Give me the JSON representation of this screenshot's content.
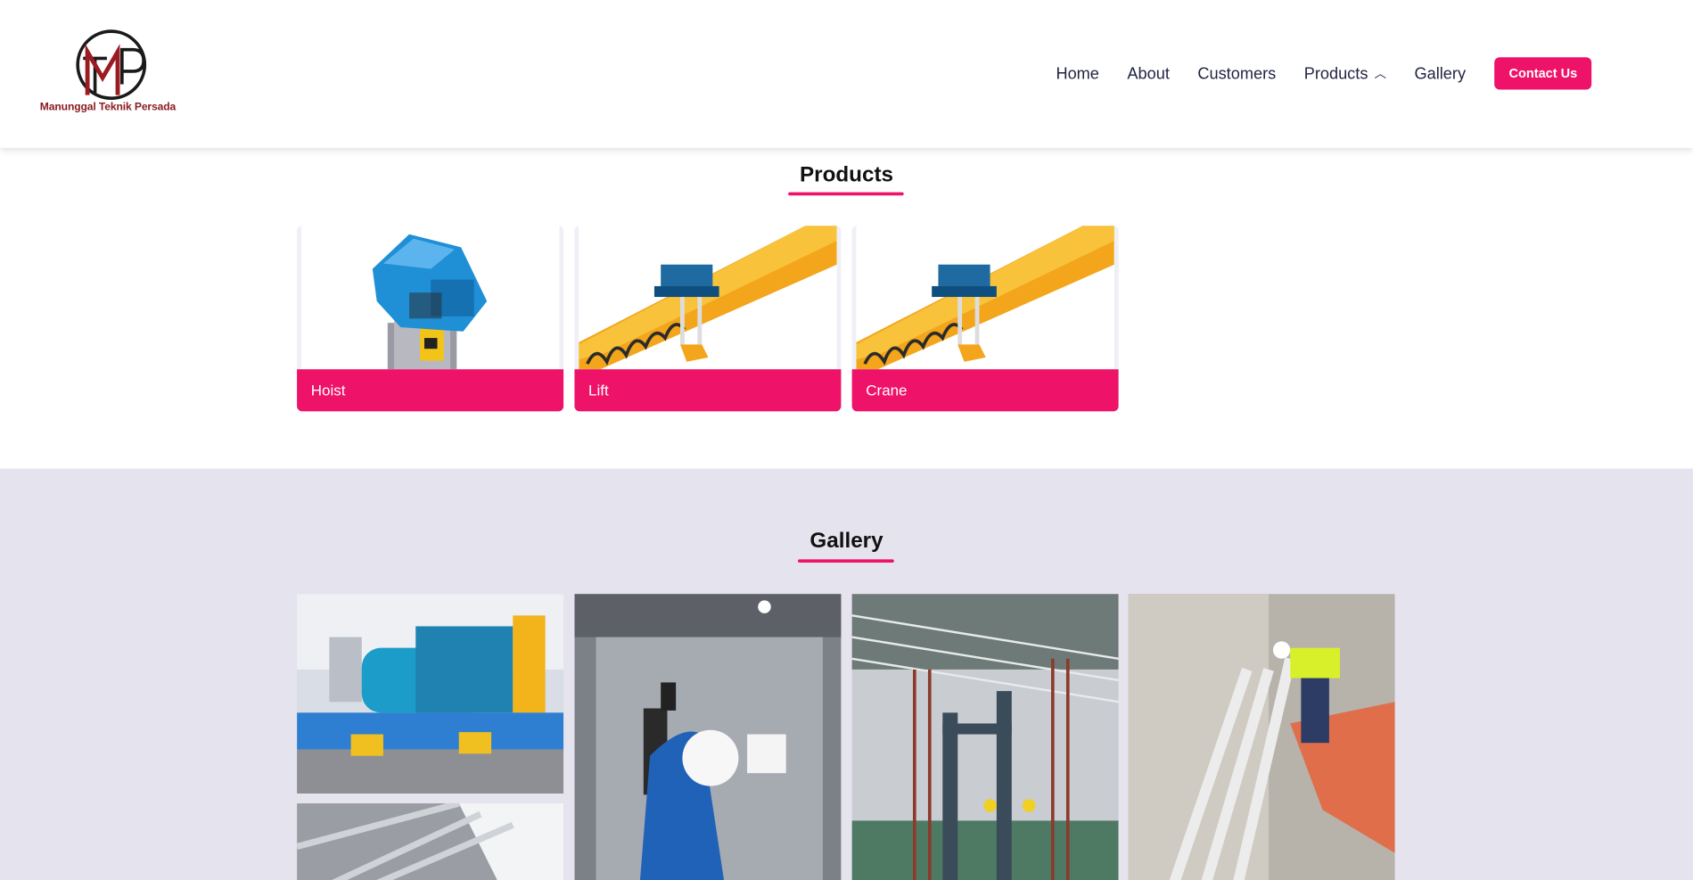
{
  "brand": {
    "name": "Manunggal Teknik Persada",
    "logo_letters": "TMP",
    "colors": {
      "dark_red": "#8a1c22",
      "accent": "#ee1268"
    }
  },
  "nav": {
    "items": [
      {
        "label": "Home"
      },
      {
        "label": "About"
      },
      {
        "label": "Customers"
      },
      {
        "label": "Products",
        "icon": "chevron-up-icon"
      },
      {
        "label": "Gallery"
      }
    ],
    "contact_label": "Contact Us"
  },
  "products": {
    "title": "Products",
    "cards": [
      {
        "label": "Hoist"
      },
      {
        "label": "Lift"
      },
      {
        "label": "Crane"
      }
    ]
  },
  "gallery": {
    "title": "Gallery"
  }
}
